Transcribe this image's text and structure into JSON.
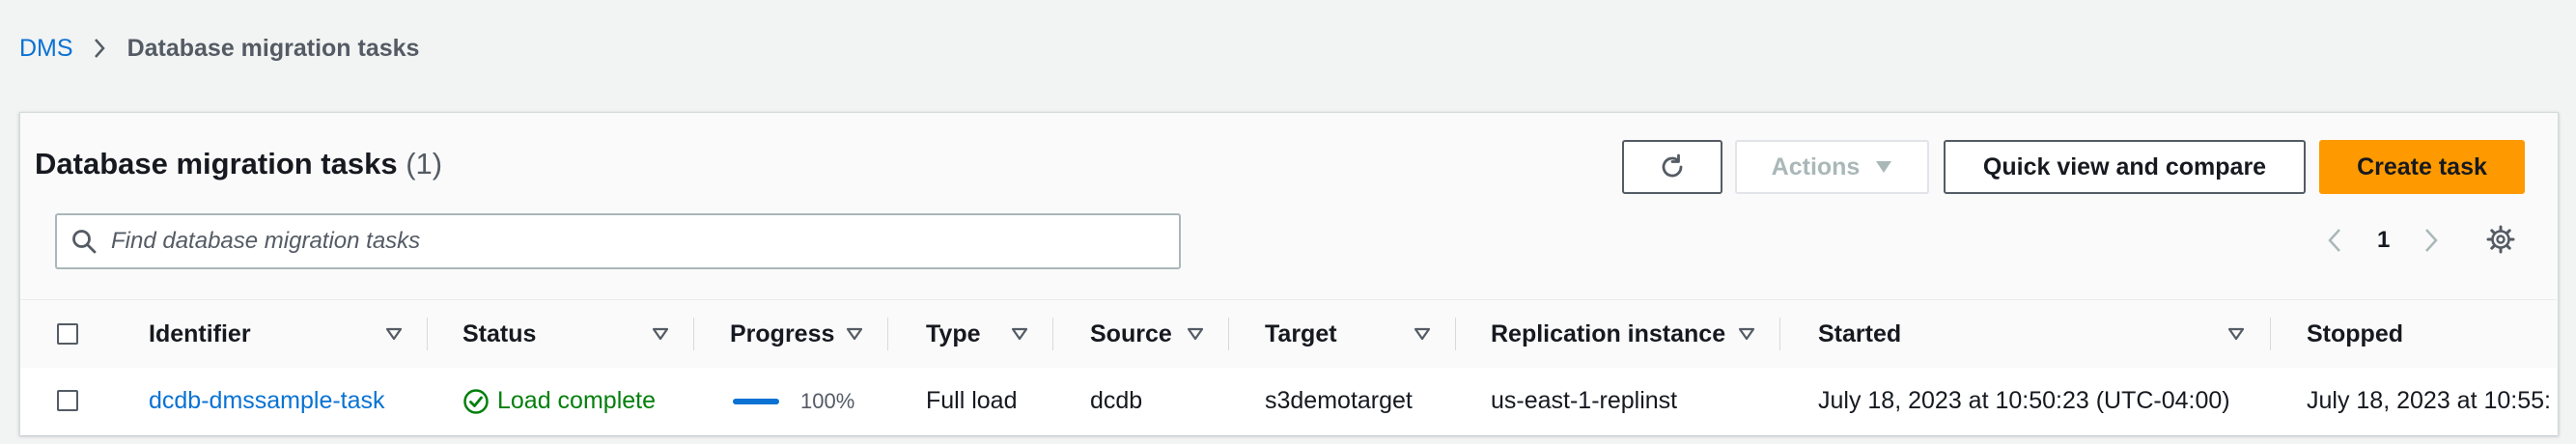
{
  "breadcrumb": {
    "root": "DMS",
    "current": "Database migration tasks"
  },
  "panel": {
    "title": "Database migration tasks",
    "count": "(1)",
    "actions_label": "Actions",
    "quick_view_label": "Quick view and compare",
    "create_label": "Create task",
    "search_placeholder": "Find database migration tasks",
    "search_value": "",
    "page_number": "1"
  },
  "colors": {
    "accent": "#ff9900",
    "link": "#0972d3",
    "success": "#037f0c"
  },
  "icons": {
    "refresh": "refresh-icon",
    "caret": "caret-down-icon",
    "search": "search-icon",
    "prev": "chevron-left-icon",
    "next": "chevron-right-icon",
    "settings": "gear-icon",
    "sort": "sort-caret-icon",
    "status": "check-circle-icon"
  },
  "table": {
    "columns": [
      "Identifier",
      "Status",
      "Progress",
      "Type",
      "Source",
      "Target",
      "Replication instance",
      "Started",
      "Stopped"
    ],
    "rows": [
      {
        "identifier": "dcdb-dmssample-task",
        "status": "Load complete",
        "progress": 1.0,
        "progress_label": "100%",
        "type": "Full load",
        "source": "dcdb",
        "target": "s3demotarget",
        "replication_instance": "us-east-1-replinst",
        "started": "July 18, 2023 at 10:50:23 (UTC-04:00)",
        "stopped": "July 18, 2023 at 10:55:"
      }
    ]
  }
}
